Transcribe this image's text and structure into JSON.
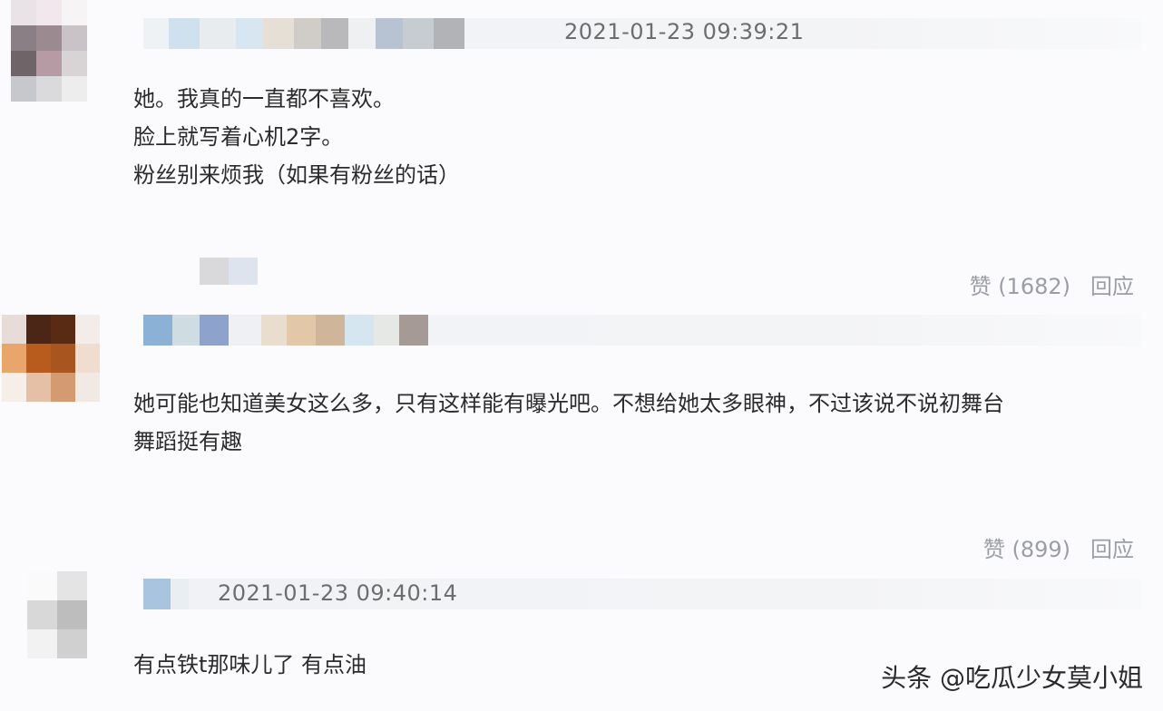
{
  "comments": [
    {
      "timestamp": "2021-01-23 09:39:21",
      "lines": [
        "她。我真的一直都不喜欢。",
        "脸上就写着心机2字。",
        "粉丝别来烦我（如果有粉丝的话）"
      ],
      "like_label": "赞 (1682)",
      "reply_label": "回应"
    },
    {
      "timestamp": "",
      "lines": [
        "她可能也知道美女这么多，只有这样能有曝光吧。不想给她太多眼神，不过该说不说初舞台",
        "舞蹈挺有趣"
      ],
      "like_label": "赞 (899)",
      "reply_label": "回应"
    },
    {
      "timestamp": "2021-01-23 09:40:14",
      "lines": [
        "有点铁t那味儿了 有点油"
      ]
    }
  ],
  "watermark": "头条 @吃瓜少女莫小姐",
  "colors": {
    "text": "#2b2b2b",
    "timestamp": "#6d6d6d",
    "action": "#9b9ea5"
  }
}
